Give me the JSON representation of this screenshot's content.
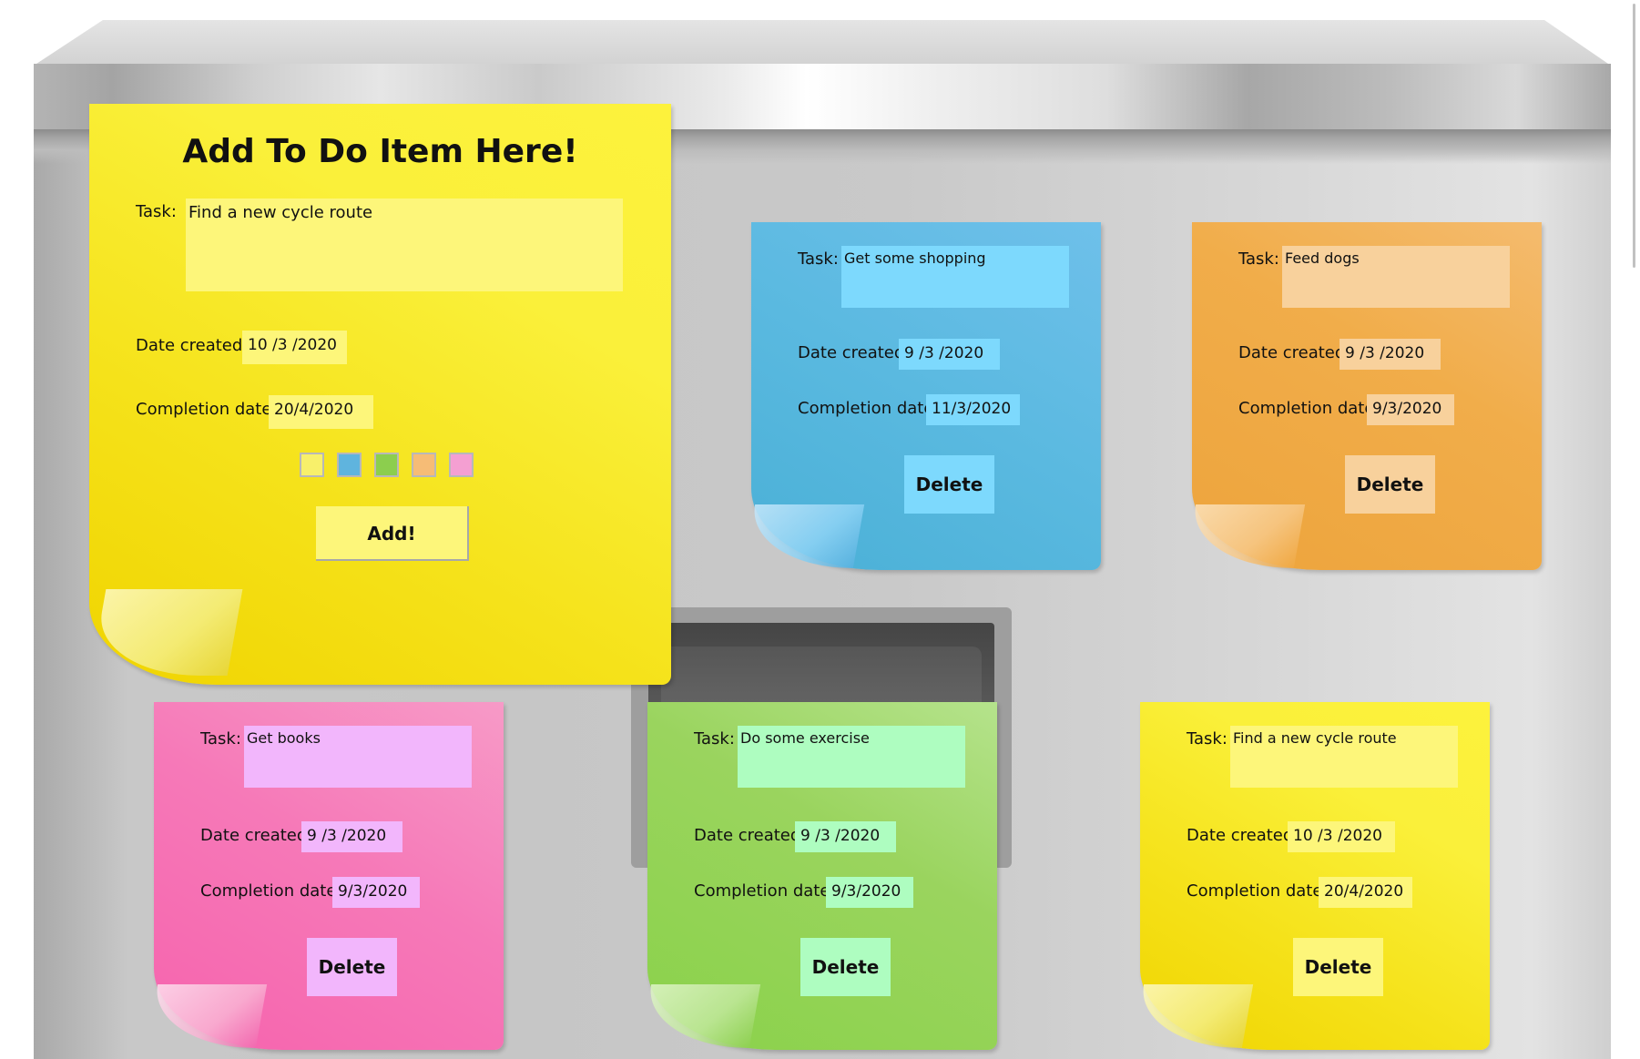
{
  "add_form": {
    "title": "Add To Do Item Here!",
    "task_label": "Task:",
    "task_value": "Find a new cycle route",
    "date_created_label": "Date created:",
    "date_created_value": "10 /3 /2020",
    "completion_label": "Completion date:",
    "completion_value": "20/4/2020",
    "color_options": [
      "#f8f06a",
      "#5fb4de",
      "#8cce4e",
      "#f6bc76",
      "#f49fd2"
    ],
    "add_label": "Add!"
  },
  "notes": [
    {
      "color": "blue",
      "task_label": "Task:",
      "task": "Get some shopping",
      "date_created_label": "Date created:",
      "date_created": "9 /3 /2020",
      "completion_label": "Completion date:",
      "completion": "11/3/2020",
      "delete_label": "Delete"
    },
    {
      "color": "orange",
      "task_label": "Task:",
      "task": "Feed dogs",
      "date_created_label": "Date created:",
      "date_created": "9 /3 /2020",
      "completion_label": "Completion date:",
      "completion": "9/3/2020",
      "delete_label": "Delete"
    },
    {
      "color": "pink",
      "task_label": "Task:",
      "task": "Get books",
      "date_created_label": "Date created:",
      "date_created": "9 /3 /2020",
      "completion_label": "Completion date:",
      "completion": "9/3/2020",
      "delete_label": "Delete"
    },
    {
      "color": "green",
      "task_label": "Task:",
      "task": "Do some exercise",
      "date_created_label": "Date created:",
      "date_created": "9 /3 /2020",
      "completion_label": "Completion date:",
      "completion": "9/3/2020",
      "delete_label": "Delete"
    },
    {
      "color": "yellow",
      "task_label": "Task:",
      "task": "Find a new cycle route",
      "date_created_label": "Date created:",
      "date_created": "10 /3 /2020",
      "completion_label": "Completion date:",
      "completion": "20/4/2020",
      "delete_label": "Delete"
    }
  ]
}
